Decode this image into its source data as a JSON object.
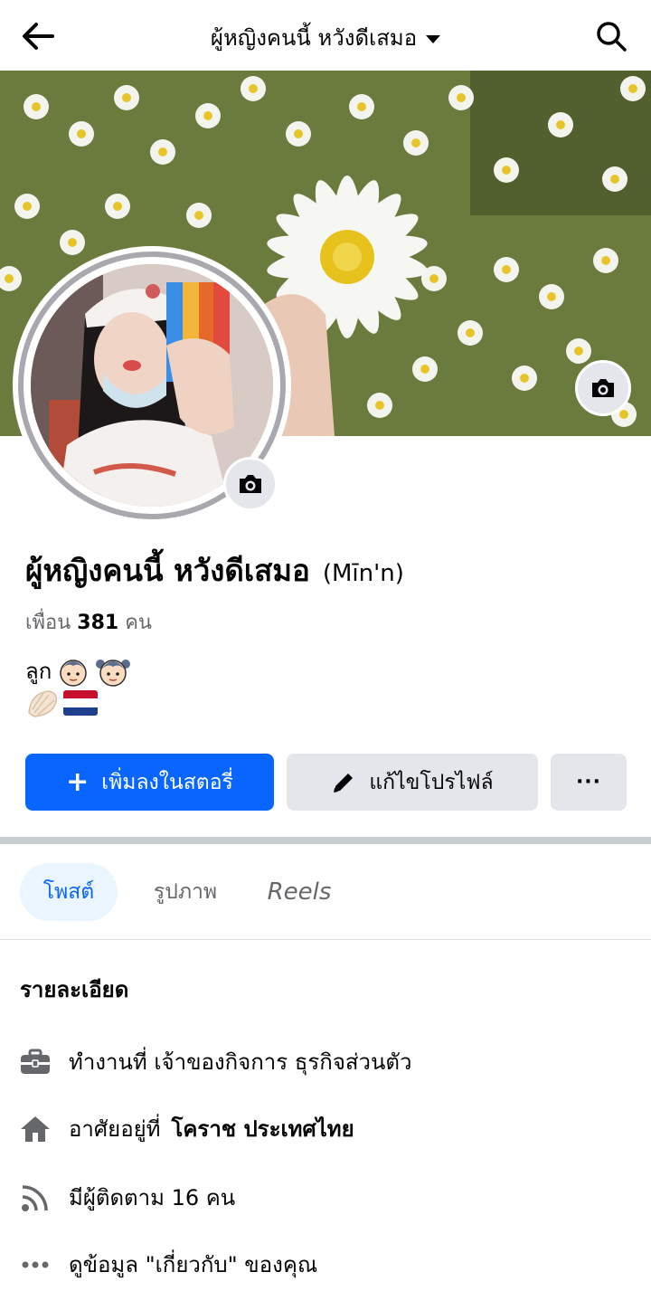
{
  "header": {
    "title": "ผู้หญิงคนนี้ หวังดีเสมอ"
  },
  "profile": {
    "name": "ผู้หญิงคนนี้ หวังดีเสมอ",
    "alt_name": "(Mīn'n)",
    "friends_prefix": "เพื่อน",
    "friends_count": "381",
    "friends_suffix": "คน",
    "bio_line1_text": "ลูก"
  },
  "actions": {
    "add_story_label": "เพิ่มลงในสตอรี่",
    "edit_profile_label": "แก้ไขโปรไฟล์",
    "more_label": "···"
  },
  "tabs": [
    {
      "label": "โพสต์",
      "active": true
    },
    {
      "label": "รูปภาพ",
      "active": false
    },
    {
      "label": "Reels",
      "active": false
    }
  ],
  "details": {
    "title": "รายละเอียด",
    "work": "ทำงานที่ เจ้าของกิจการ ธุรกิจส่วนตัว",
    "lives_prefix": "อาศัยอยู่ที่",
    "lives_place": "โคราช ประเทศไทย",
    "followers": "มีผู้ติดตาม 16 คน",
    "about": "ดูข้อมูล \"เกี่ยวกับ\" ของคุณ"
  },
  "colors": {
    "primary": "#0866ff",
    "secondary_bg": "#e4e6eb",
    "muted_text": "#65676b",
    "tab_active_bg": "#ebf5ff"
  }
}
